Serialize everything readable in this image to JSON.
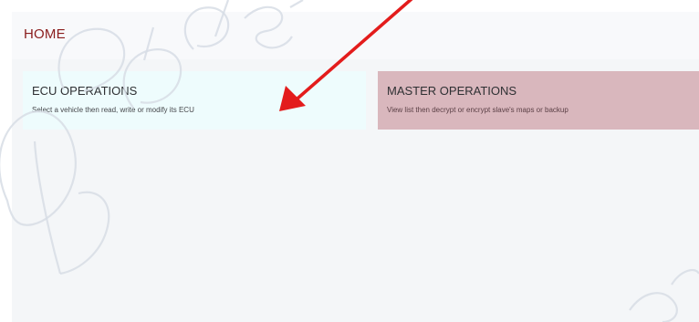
{
  "header": {
    "title": "HOME"
  },
  "cards": [
    {
      "title": "ECU OPERATIONS",
      "description": "Select a vehicle then read, write or modify its ECU"
    },
    {
      "title": "MASTER OPERATIONS",
      "description": "View list then decrypt or encrypt slave's maps or backup"
    }
  ],
  "colors": {
    "title_accent": "#8a1d1d",
    "ecu_card_bg": "#eefcfd",
    "master_card_bg": "#d9b7bd",
    "annotation_arrow": "#e31c1c"
  },
  "icons": {
    "annotation": "red-arrow"
  }
}
